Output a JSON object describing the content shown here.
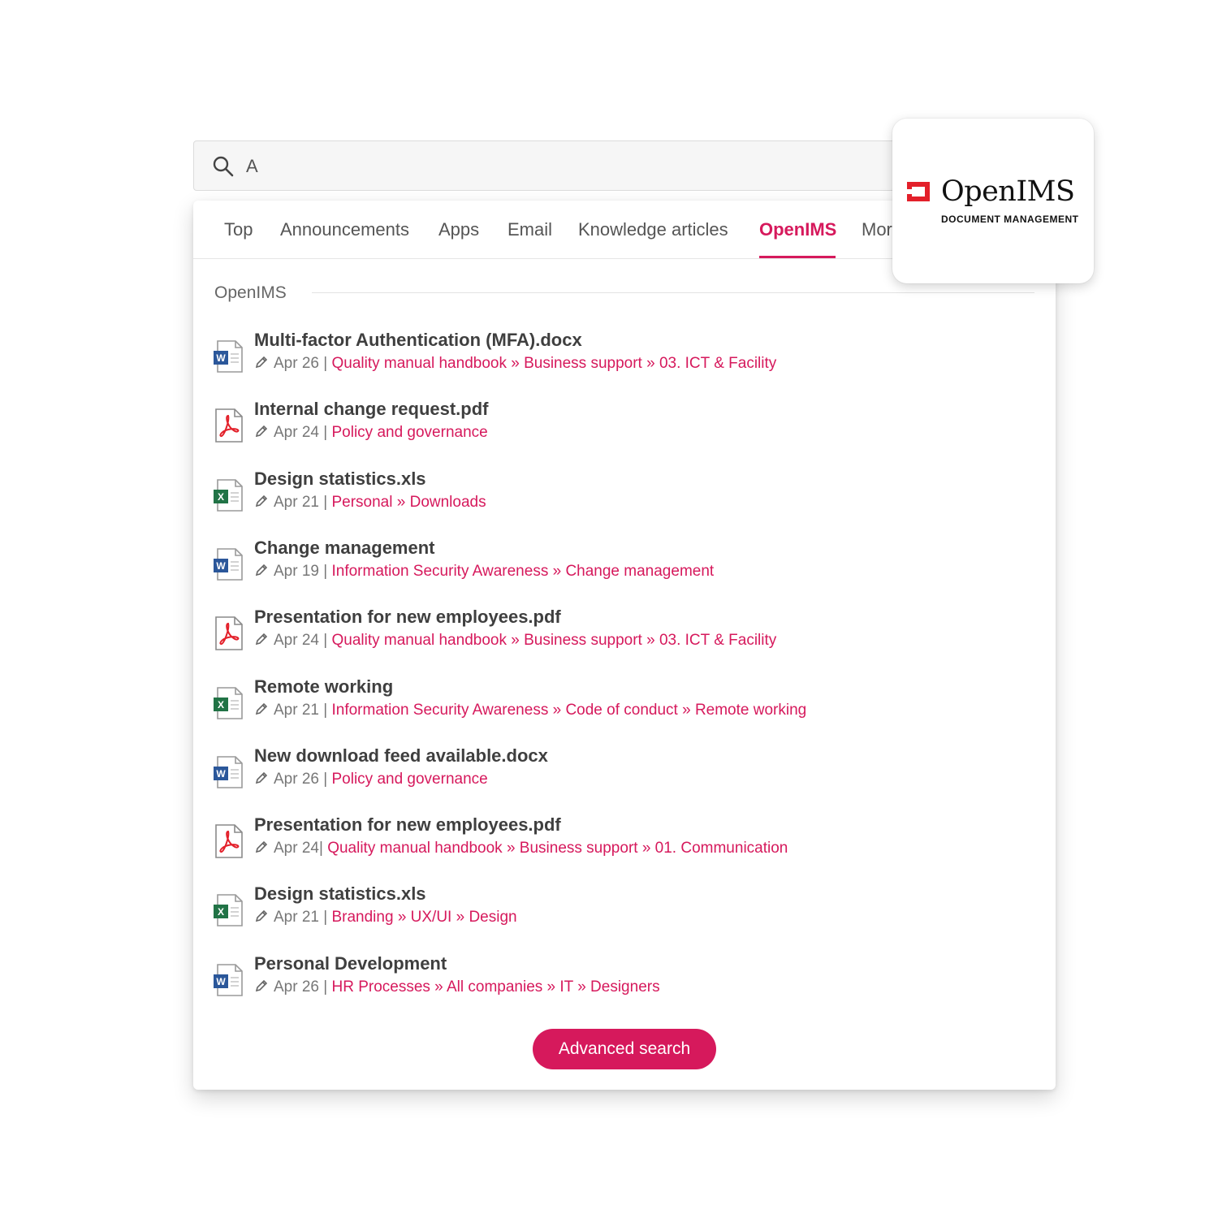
{
  "search": {
    "query": "A"
  },
  "tabs": [
    {
      "label": "Top"
    },
    {
      "label": "Announcements"
    },
    {
      "label": "Apps"
    },
    {
      "label": "Email"
    },
    {
      "label": "Knowledge articles"
    },
    {
      "label": "OpenIMS"
    },
    {
      "label": "Mor"
    }
  ],
  "active_tab": "OpenIMS",
  "section": {
    "title": "OpenIMS"
  },
  "results": [
    {
      "type": "word",
      "title": "Multi-factor Authentication (MFA).docx",
      "date": "Apr 26 |",
      "path": "Quality manual handbook  » Business support » 03. ICT & Facility"
    },
    {
      "type": "pdf",
      "title": "Internal change request.pdf",
      "date": "Apr 24 |",
      "path": "Policy and governance"
    },
    {
      "type": "excel",
      "title": "Design statistics.xls",
      "date": "Apr 21 |",
      "path": "Personal » Downloads"
    },
    {
      "type": "word",
      "title": "Change management",
      "date": "Apr 19 |",
      "path": "Information Security Awareness » Change management"
    },
    {
      "type": "pdf",
      "title": "Presentation for new employees.pdf",
      "date": "Apr 24 |",
      "path": "Quality manual handbook  » Business support » 03. ICT & Facility"
    },
    {
      "type": "excel",
      "title": "Remote working",
      "date": "Apr 21 |",
      "path": "Information Security Awareness » Code of conduct » Remote working"
    },
    {
      "type": "word",
      "title": "New download feed available.docx",
      "date": "Apr 26 |",
      "path": "Policy and governance"
    },
    {
      "type": "pdf",
      "title": "Presentation for new employees.pdf",
      "date": "Apr 24|",
      "path": "Quality manual handbook  » Business support » 01. Communication"
    },
    {
      "type": "excel",
      "title": "Design statistics.xls",
      "date": "Apr 21 |",
      "path": "Branding » UX/UI » Design"
    },
    {
      "type": "word",
      "title": "Personal Development",
      "date": "Apr 26 |",
      "path": "HR Processes » All companies » IT » Designers"
    }
  ],
  "advanced_search": {
    "label": "Advanced search"
  },
  "brand": {
    "name": "OpenIMS",
    "tagline": "DOCUMENT MANAGEMENT"
  },
  "colors": {
    "accent": "#d6195c",
    "brand_red": "#e3202a",
    "word_blue": "#2b579a",
    "excel_green": "#217346",
    "pdf_red": "#e3202a"
  }
}
